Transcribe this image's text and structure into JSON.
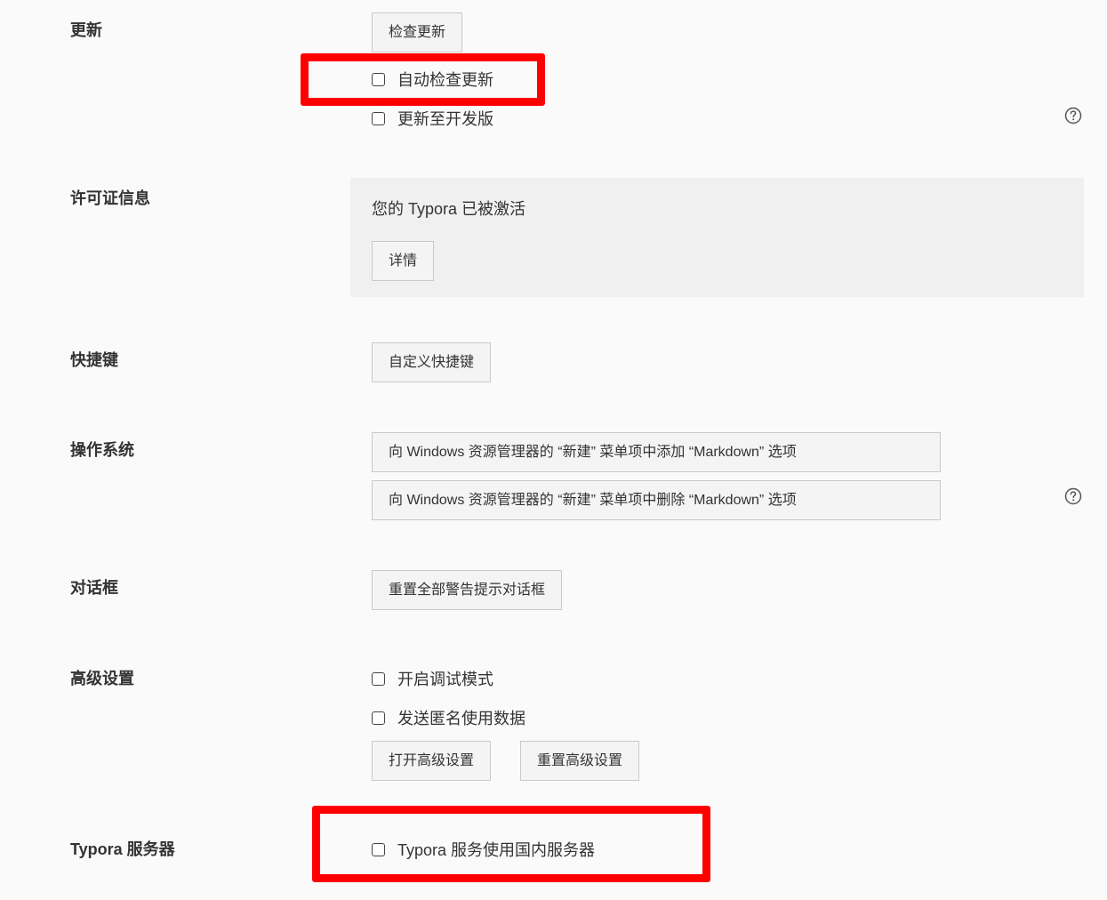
{
  "sections": {
    "update": {
      "label": "更新",
      "check_button": "检查更新",
      "auto_check": "自动检查更新",
      "dev_channel": "更新至开发版"
    },
    "license": {
      "label": "许可证信息",
      "status": "您的 Typora 已被激活",
      "details_button": "详情"
    },
    "shortcuts": {
      "label": "快捷键",
      "custom_button": "自定义快捷键"
    },
    "os": {
      "label": "操作系统",
      "add_button": "向 Windows 资源管理器的 “新建” 菜单项中添加 “Markdown” 选项",
      "remove_button": "向 Windows 资源管理器的 “新建” 菜单项中删除 “Markdown” 选项"
    },
    "dialogs": {
      "label": "对话框",
      "reset_button": "重置全部警告提示对话框"
    },
    "advanced": {
      "label": "高级设置",
      "debug_mode": "开启调试模式",
      "send_usage": "发送匿名使用数据",
      "open_button": "打开高级设置",
      "reset_button": "重置高级设置"
    },
    "server": {
      "label": "Typora 服务器",
      "domestic": "Typora 服务使用国内服务器"
    }
  },
  "colors": {
    "highlight": "#ff0000",
    "background": "#fafafa",
    "panel": "#f0f0f0"
  },
  "icons": {
    "help": "question-circle-icon"
  }
}
